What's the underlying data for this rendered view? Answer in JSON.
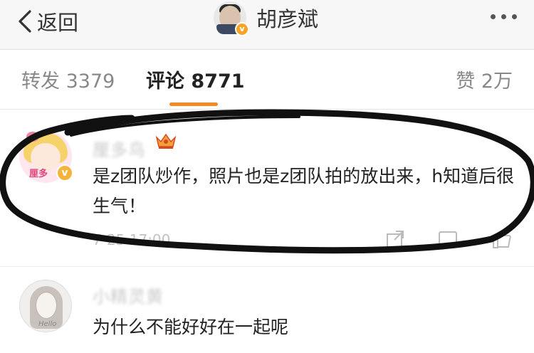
{
  "navbar": {
    "back_label": "返回",
    "title": "胡彦斌"
  },
  "tabs": {
    "repost": "转发 3379",
    "comments": "评论 8771",
    "likes": "赞 2万",
    "active": "comments"
  },
  "comments": [
    {
      "username": "厘多鸟",
      "avatar_text": "厘多",
      "text": "是z团队炒作，照片也是z团队拍的放出来，h知道后很生气！",
      "time": "7-25 17:00",
      "badges": [
        "crown-icon",
        "gold-verified-badge"
      ]
    },
    {
      "username": "小精灵黄",
      "avatar_text": "Hello",
      "text": "为什么不能好好在一起呢"
    }
  ],
  "colors": {
    "accent_tab_underline": "#f08a24",
    "verified_badge": "#f7a228",
    "marker_ink": "#111111"
  }
}
